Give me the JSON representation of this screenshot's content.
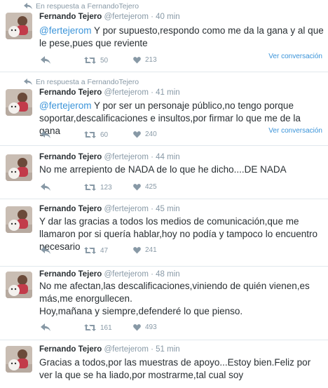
{
  "reply_context": "En respuesta a FernandoTejero",
  "conversation_link": "Ver conversación",
  "tweets": [
    {
      "name": "Fernando Tejero",
      "handle": "@fertejerom",
      "time": "· 40 min",
      "mention": "@fertejerom",
      "text": " Y por supuesto,respondo como me da la gana y al que le pese,pues que reviente",
      "retweets": "50",
      "likes": "213",
      "is_reply": true
    },
    {
      "name": "Fernando Tejero",
      "handle": "@fertejerom",
      "time": "· 41 min",
      "mention": "@fertejerom",
      "text": " Y por ser un personaje público,no tengo porque soportar,descalificaciones e insultos,por firmar lo que me de la gana",
      "retweets": "60",
      "likes": "240",
      "is_reply": true
    },
    {
      "name": "Fernando Tejero",
      "handle": "@fertejerom",
      "time": "· 44 min",
      "text": "No me arrepiento de NADA de lo que he dicho....DE NADA",
      "retweets": "123",
      "likes": "425"
    },
    {
      "name": "Fernando Tejero",
      "handle": "@fertejerom",
      "time": "· 45 min",
      "text": "Y dar las gracias a todos los medios de comunicación,que me llamaron por si quería hablar,hoy no podía y tampoco lo encuentro necesario",
      "retweets": "47",
      "likes": "241"
    },
    {
      "name": "Fernando Tejero",
      "handle": "@fertejerom",
      "time": "· 48 min",
      "text": "No me afectan,las descalificaciones,viniendo de quién vienen,es más,me enorgullecen.",
      "text2": "Hoy,mañana y siempre,defenderé lo que pienso.",
      "retweets": "161",
      "likes": "493"
    },
    {
      "name": "Fernando Tejero",
      "handle": "@fertejerom",
      "time": "· 51 min",
      "text": "Gracias a todos,por las muestras de apoyo...Estoy bien.Feliz por ver la que se ha liado,por mostrarme,tal cual soy"
    }
  ],
  "icons": [
    "reply-icon",
    "retweet-icon",
    "like-icon"
  ],
  "colors": {
    "link": "#3b94d9",
    "muted": "#8899a6",
    "text": "#292f33",
    "divider": "#e1e8ed"
  }
}
